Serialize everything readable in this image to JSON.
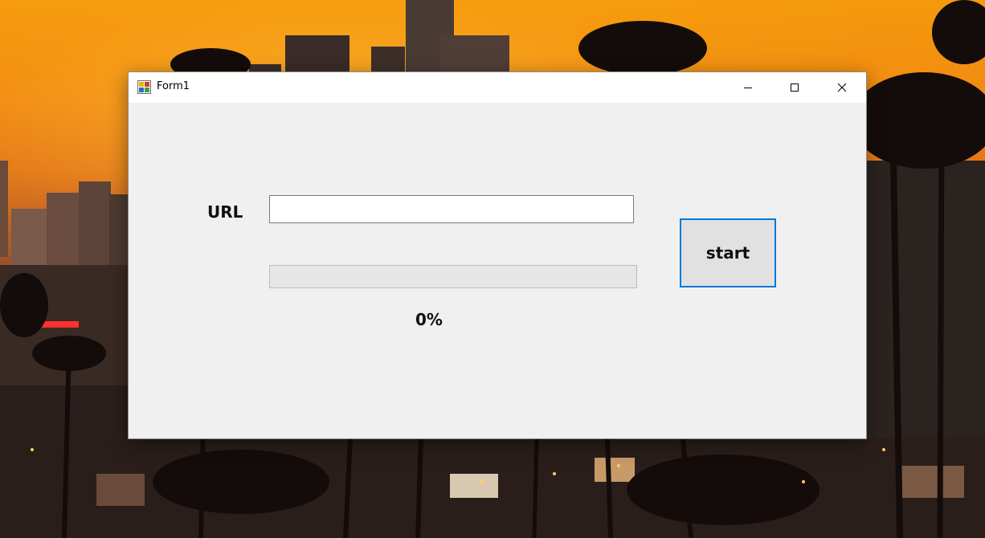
{
  "window": {
    "title": "Form1",
    "controls": {
      "minimize": "minimize-icon",
      "maximize": "maximize-icon",
      "close": "close-icon"
    }
  },
  "form": {
    "url_label": "URL",
    "url_value": "",
    "progress_value": 0,
    "percent_text": "0%",
    "start_label": "start"
  },
  "colors": {
    "accent": "#0078d7",
    "window_bg": "#f0f0f0",
    "titlebar_bg": "#ffffff"
  }
}
